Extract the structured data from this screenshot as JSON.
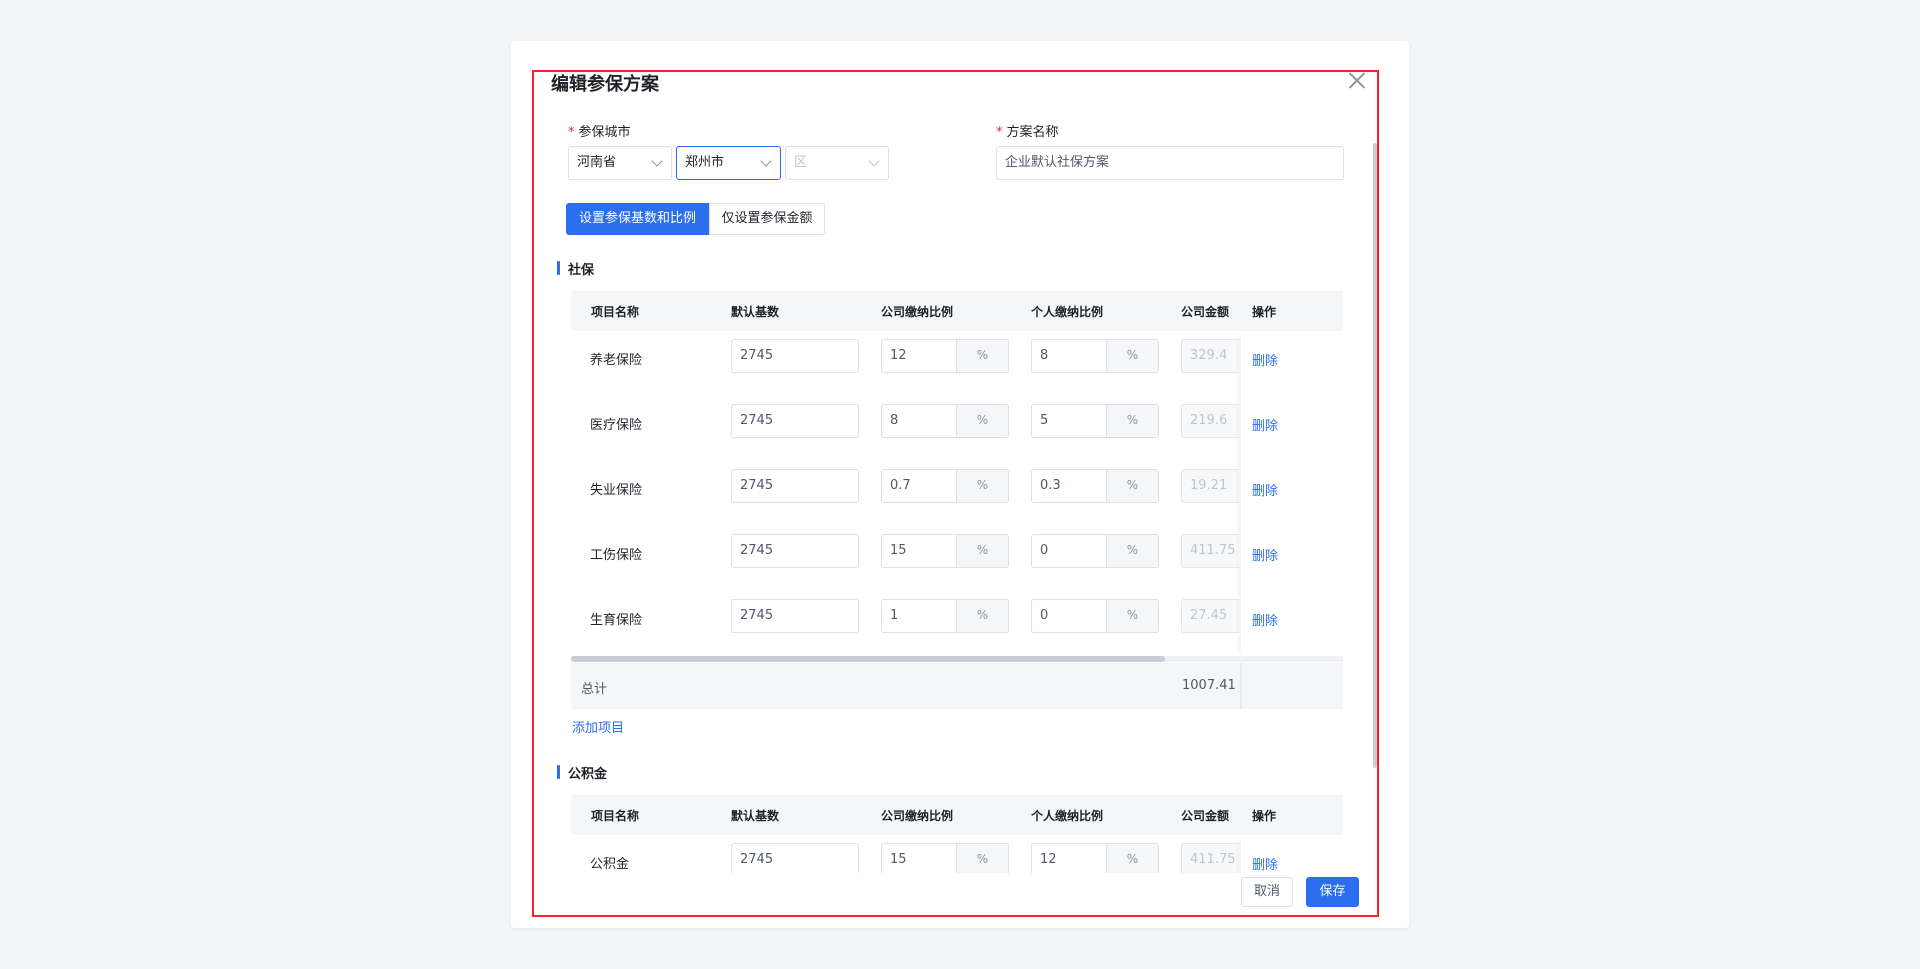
{
  "dialog": {
    "title": "编辑参保方案",
    "city_label": "参保城市",
    "province": "河南省",
    "city": "郑州市",
    "district_placeholder": "区",
    "plan_name_label": "方案名称",
    "plan_name_value": "企业默认社保方案",
    "tabs": [
      "设置参保基数和比例",
      "仅设置参保金额"
    ]
  },
  "columns": [
    "项目名称",
    "默认基数",
    "公司缴纳比例",
    "个人缴纳比例",
    "公司金额",
    "操作"
  ],
  "percent_unit": "%",
  "delete_label": "删除",
  "social": {
    "title": "社保",
    "rows": [
      {
        "name": "养老保险",
        "base": "2745",
        "company_rate": "12",
        "personal_rate": "8",
        "company_amount": "329.4"
      },
      {
        "name": "医疗保险",
        "base": "2745",
        "company_rate": "8",
        "personal_rate": "5",
        "company_amount": "219.6"
      },
      {
        "name": "失业保险",
        "base": "2745",
        "company_rate": "0.7",
        "personal_rate": "0.3",
        "company_amount": "19.21"
      },
      {
        "name": "工伤保险",
        "base": "2745",
        "company_rate": "15",
        "personal_rate": "0",
        "company_amount": "411.75"
      },
      {
        "name": "生育保险",
        "base": "2745",
        "company_rate": "1",
        "personal_rate": "0",
        "company_amount": "27.45"
      }
    ],
    "total_label": "总计",
    "total_value": "1007.41",
    "add_label": "添加项目"
  },
  "fund": {
    "title": "公积金",
    "rows": [
      {
        "name": "公积金",
        "base": "2745",
        "company_rate": "15",
        "personal_rate": "12",
        "company_amount": "411.75"
      }
    ]
  },
  "footer": {
    "cancel": "取消",
    "save": "保存"
  }
}
